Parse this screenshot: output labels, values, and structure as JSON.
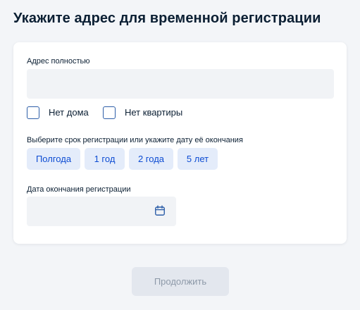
{
  "page": {
    "title": "Укажите адрес для временной регистрации"
  },
  "form": {
    "address": {
      "label": "Адрес полностью",
      "value": "",
      "placeholder": ""
    },
    "checkboxes": [
      {
        "label": "Нет дома",
        "checked": false
      },
      {
        "label": "Нет квартиры",
        "checked": false
      }
    ],
    "period": {
      "label": "Выберите срок регистрации или укажите дату её окончания",
      "options": [
        {
          "label": "Полгода"
        },
        {
          "label": "1 год"
        },
        {
          "label": "2 года"
        },
        {
          "label": "5 лет"
        }
      ]
    },
    "end_date": {
      "label": "Дата окончания регистрации",
      "value": "",
      "placeholder": "",
      "icon": "calendar-icon"
    }
  },
  "actions": {
    "submit_label": "Продолжить",
    "submit_enabled": false
  },
  "colors": {
    "background": "#f3f5f8",
    "card": "#ffffff",
    "input_fill": "#f1f3f6",
    "chip_fill": "#e4ecfa",
    "accent": "#0d4cd3",
    "checkbox_border": "#2d5ea8",
    "disabled_button_fill": "#e3e7ee",
    "disabled_button_text": "#8d99a8"
  }
}
